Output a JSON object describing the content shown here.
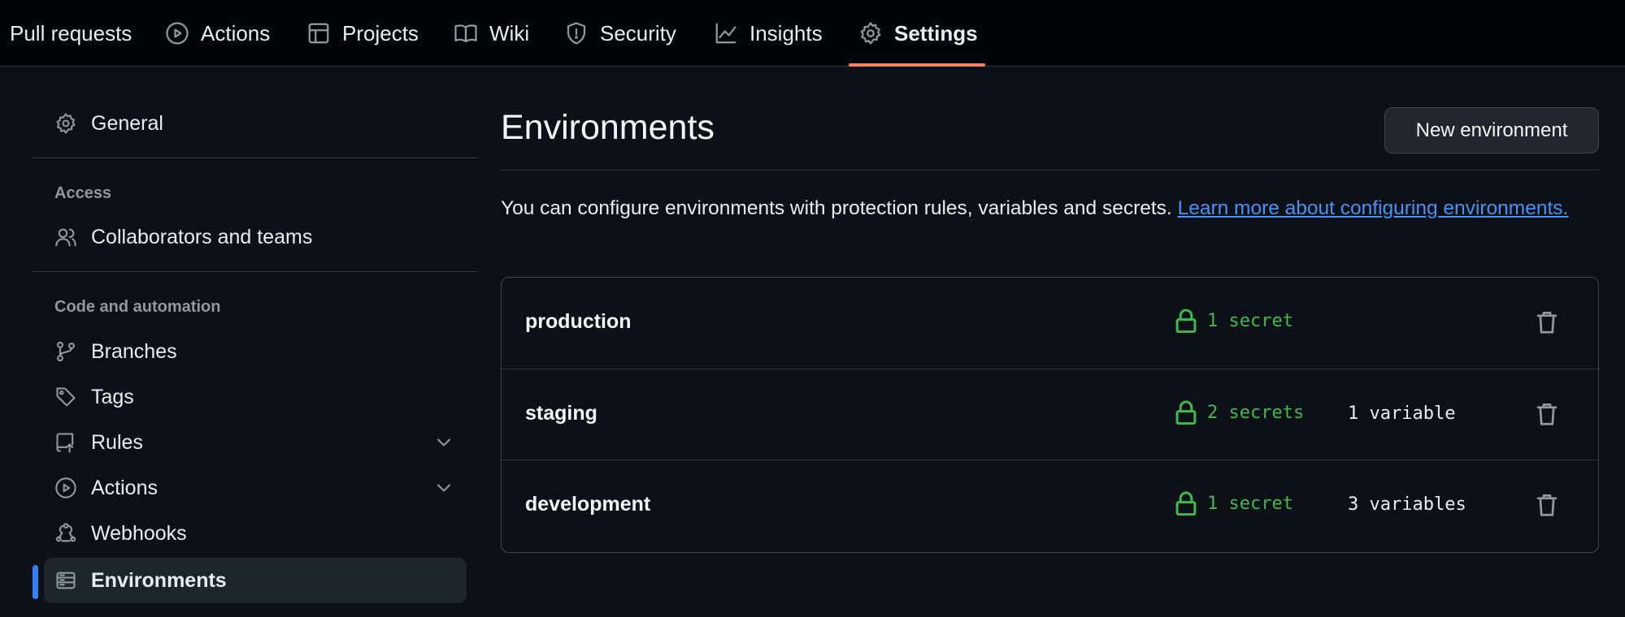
{
  "colors": {
    "background": "#0d1117",
    "topnav_background": "#010409",
    "active_tab_underline": "#f78166",
    "link": "#4493f8",
    "secret_green": "#3fb950",
    "selected_marker": "#2f81f7"
  },
  "topnav": {
    "tabs": [
      {
        "label": "Pull requests",
        "icon": "pull-request-icon"
      },
      {
        "label": "Actions",
        "icon": "play-icon"
      },
      {
        "label": "Projects",
        "icon": "table-icon"
      },
      {
        "label": "Wiki",
        "icon": "book-icon"
      },
      {
        "label": "Security",
        "icon": "shield-icon"
      },
      {
        "label": "Insights",
        "icon": "graph-icon"
      },
      {
        "label": "Settings",
        "icon": "gear-icon",
        "active": true
      }
    ]
  },
  "sidebar": {
    "general": {
      "label": "General",
      "icon": "gear-icon"
    },
    "access_heading": "Access",
    "collaborators": {
      "label": "Collaborators and teams",
      "icon": "people-icon"
    },
    "code_heading": "Code and automation",
    "branches": {
      "label": "Branches",
      "icon": "git-branch-icon"
    },
    "tags": {
      "label": "Tags",
      "icon": "tag-icon"
    },
    "rules": {
      "label": "Rules",
      "icon": "repo-push-icon"
    },
    "actions": {
      "label": "Actions",
      "icon": "play-icon"
    },
    "webhooks": {
      "label": "Webhooks",
      "icon": "webhook-icon"
    },
    "environments": {
      "label": "Environments",
      "icon": "server-icon",
      "selected": true
    }
  },
  "main": {
    "title": "Environments",
    "new_button": "New environment",
    "description": "You can configure environments with protection rules, variables and secrets.",
    "learn_more": "Learn more about configuring environments.",
    "environments": [
      {
        "name": "production",
        "secrets": "1 secret",
        "variables": ""
      },
      {
        "name": "staging",
        "secrets": "2 secrets",
        "variables": "1 variable"
      },
      {
        "name": "development",
        "secrets": "1 secret",
        "variables": "3 variables"
      }
    ]
  }
}
